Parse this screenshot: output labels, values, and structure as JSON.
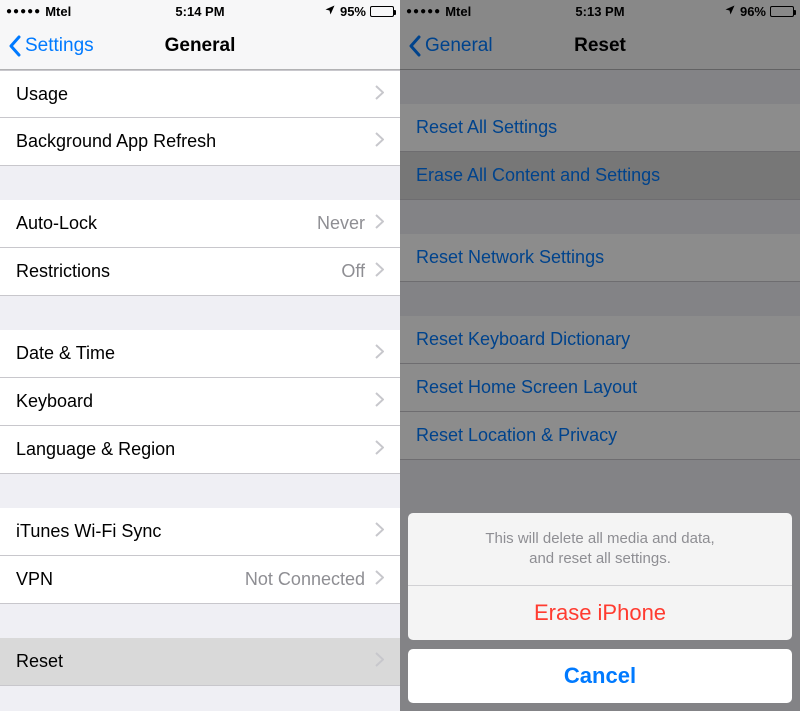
{
  "left": {
    "status": {
      "carrier": "Mtel",
      "time": "5:14 PM",
      "battery_pct": "95%"
    },
    "nav": {
      "back": "Settings",
      "title": "General"
    },
    "groups": [
      [
        {
          "label": "Usage",
          "value": ""
        },
        {
          "label": "Background App Refresh",
          "value": ""
        }
      ],
      [
        {
          "label": "Auto-Lock",
          "value": "Never"
        },
        {
          "label": "Restrictions",
          "value": "Off"
        }
      ],
      [
        {
          "label": "Date & Time",
          "value": ""
        },
        {
          "label": "Keyboard",
          "value": ""
        },
        {
          "label": "Language & Region",
          "value": ""
        }
      ],
      [
        {
          "label": "iTunes Wi-Fi Sync",
          "value": ""
        },
        {
          "label": "VPN",
          "value": "Not Connected"
        }
      ],
      [
        {
          "label": "Reset",
          "value": "",
          "pressed": true
        }
      ]
    ]
  },
  "right": {
    "status": {
      "carrier": "Mtel",
      "time": "5:13 PM",
      "battery_pct": "96%"
    },
    "nav": {
      "back": "General",
      "title": "Reset"
    },
    "groups": [
      [
        {
          "label": "Reset All Settings"
        },
        {
          "label": "Erase All Content and Settings",
          "pressed": true
        }
      ],
      [
        {
          "label": "Reset Network Settings"
        }
      ],
      [
        {
          "label": "Reset Keyboard Dictionary"
        },
        {
          "label": "Reset Home Screen Layout"
        },
        {
          "label": "Reset Location & Privacy"
        }
      ]
    ],
    "sheet": {
      "message_l1": "This will delete all media and data,",
      "message_l2": "and reset all settings.",
      "destructive": "Erase iPhone",
      "cancel": "Cancel"
    }
  }
}
